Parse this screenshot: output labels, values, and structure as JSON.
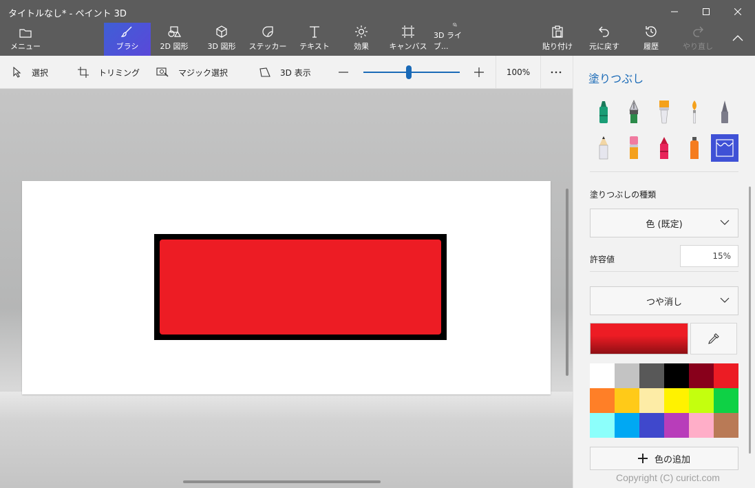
{
  "window": {
    "title": "タイトルなし* - ペイント 3D",
    "controls": [
      "minimize-icon",
      "maximize-icon",
      "close-icon"
    ]
  },
  "ribbon": {
    "menu": "メニュー",
    "brushes": "ブラシ",
    "shapes2d": "2D 図形",
    "shapes3d": "3D 図形",
    "stickers": "ステッカー",
    "text": "テキスト",
    "effects": "効果",
    "canvas": "キャンバス",
    "library3d": "3D ライブ...",
    "paste": "貼り付け",
    "undo": "元に戻す",
    "history": "履歴",
    "redo": "やり直し"
  },
  "toolbar": {
    "select": "選択",
    "crop": "トリミング",
    "magic_select": "マジック選択",
    "view3d": "3D 表示",
    "zoom": "100%",
    "zoom_level": 0.47
  },
  "panel": {
    "title": "塗りつぶし",
    "fill_type_label": "塗りつぶしの種類",
    "fill_type_value": "色 (既定)",
    "tolerance_label": "許容値",
    "tolerance_value": "15%",
    "finish_value": "つや消し",
    "add_color": "色の追加",
    "accent": "#1a6ab7",
    "current_color": "#ed1c24",
    "brushes": [
      "marker-icon",
      "calligraphy-pen-icon",
      "oil-brush-icon",
      "watercolor-icon",
      "pixel-pen-icon",
      "pencil-icon",
      "eraser-icon",
      "crayon-icon",
      "spray-can-icon",
      "fill-bucket-icon"
    ],
    "palette": [
      "#ffffff",
      "#c3c3c3",
      "#585858",
      "#000000",
      "#88001b",
      "#ec1c24",
      "#ff7f27",
      "#ffca18",
      "#fdeca6",
      "#fff200",
      "#c4ff0e",
      "#0ed145",
      "#8cfffb",
      "#00a8f3",
      "#3f48cc",
      "#b83dba",
      "#ffaec8",
      "#b97a56"
    ]
  },
  "canvas": {
    "shape_fill": "#ed1c24",
    "shape_outline": "#000000"
  },
  "watermark": "Copyright (C) curict.com"
}
